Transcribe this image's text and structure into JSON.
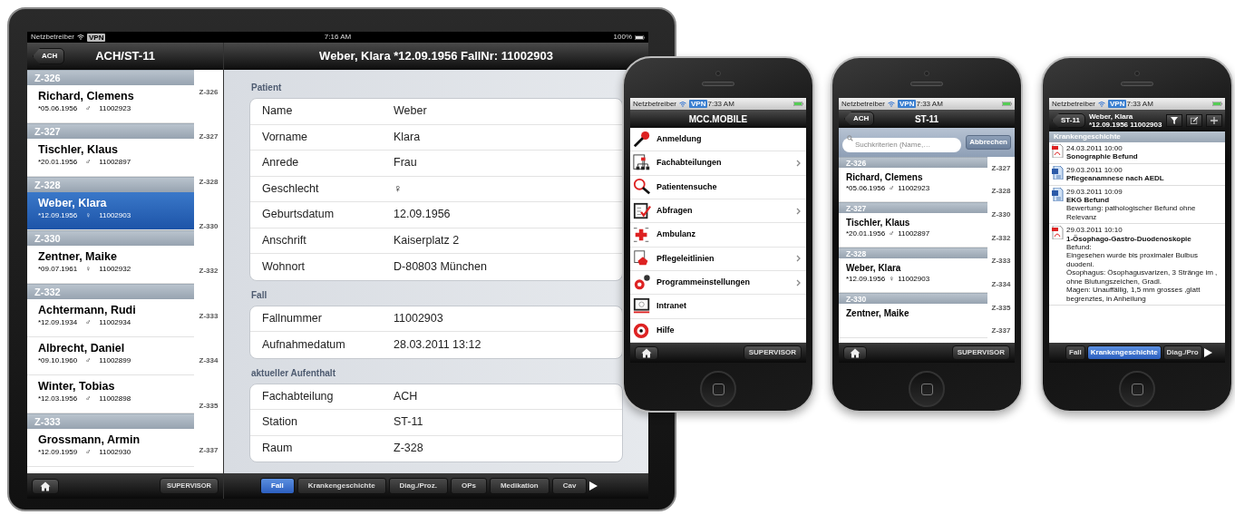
{
  "ipad": {
    "status_bar": {
      "carrier": "Netzbetreiber",
      "vpn": "VPN",
      "time": "7:16 AM",
      "battery": "100%"
    },
    "left_panel": {
      "back_button": "ACH",
      "title": "ACH/ST-11",
      "sections": [
        {
          "header": "Z-326",
          "patients": [
            {
              "name": "Richard, Clemens",
              "birth": "*05.06.1956",
              "sex": "♂",
              "case": "11002923",
              "selected": false
            }
          ]
        },
        {
          "header": "Z-327",
          "patients": [
            {
              "name": "Tischler, Klaus",
              "birth": "*20.01.1956",
              "sex": "♂",
              "case": "11002897",
              "selected": false
            }
          ]
        },
        {
          "header": "Z-328",
          "patients": [
            {
              "name": "Weber, Klara",
              "birth": "*12.09.1956",
              "sex": "♀",
              "case": "11002903",
              "selected": true
            }
          ]
        },
        {
          "header": "Z-330",
          "patients": [
            {
              "name": "Zentner, Maike",
              "birth": "*09.07.1961",
              "sex": "♀",
              "case": "11002932",
              "selected": false
            }
          ]
        },
        {
          "header": "Z-332",
          "patients": [
            {
              "name": "Achtermann, Rudi",
              "birth": "*12.09.1934",
              "sex": "♂",
              "case": "11002934",
              "selected": false
            },
            {
              "name": "Albrecht, Daniel",
              "birth": "*09.10.1960",
              "sex": "♂",
              "case": "11002899",
              "selected": false
            },
            {
              "name": "Winter, Tobias",
              "birth": "*12.03.1956",
              "sex": "♂",
              "case": "11002898",
              "selected": false
            }
          ]
        },
        {
          "header": "Z-333",
          "patients": [
            {
              "name": "Grossmann, Armin",
              "birth": "*12.09.1959",
              "sex": "♂",
              "case": "11002930",
              "selected": false
            }
          ]
        }
      ],
      "index": [
        "Z-326",
        "Z-327",
        "Z-328",
        "Z-330",
        "Z-332",
        "Z-333",
        "Z-334",
        "Z-335",
        "Z-337"
      ],
      "toolbar": {
        "right_button": "SUPERVISOR"
      }
    },
    "right_panel": {
      "title": "Weber, Klara *12.09.1956 FallNr: 11002903",
      "groups": [
        {
          "header": "Patient",
          "rows": [
            {
              "label": "Name",
              "value": "Weber"
            },
            {
              "label": "Vorname",
              "value": "Klara"
            },
            {
              "label": "Anrede",
              "value": "Frau"
            },
            {
              "label": "Geschlecht",
              "value": "♀"
            },
            {
              "label": "Geburtsdatum",
              "value": "12.09.1956"
            },
            {
              "label": "Anschrift",
              "value": "Kaiserplatz 2"
            },
            {
              "label": "Wohnort",
              "value": "D-80803 München"
            }
          ]
        },
        {
          "header": "Fall",
          "rows": [
            {
              "label": "Fallnummer",
              "value": "11002903"
            },
            {
              "label": "Aufnahmedatum",
              "value": "28.03.2011  13:12"
            }
          ]
        },
        {
          "header": "aktueller Aufenthalt",
          "rows": [
            {
              "label": "Fachabteilung",
              "value": "ACH"
            },
            {
              "label": "Station",
              "value": "ST-11"
            },
            {
              "label": "Raum",
              "value": "Z-328"
            }
          ]
        }
      ],
      "tabs": [
        {
          "label": "Fall",
          "selected": true
        },
        {
          "label": "Krankengeschichte",
          "selected": false
        },
        {
          "label": "Diag./Proz.",
          "selected": false
        },
        {
          "label": "OPs",
          "selected": false
        },
        {
          "label": "Medikation",
          "selected": false
        },
        {
          "label": "Cav",
          "selected": false
        }
      ]
    }
  },
  "phones": [
    {
      "kind": "menu",
      "status_bar": {
        "carrier": "Netzbetreiber",
        "time": "7:33 AM",
        "vpn": "VPN"
      },
      "title": "MCC.MOBILE",
      "items": [
        {
          "label": "Anmeldung",
          "chevron": false
        },
        {
          "label": "Fachabteilungen",
          "chevron": true
        },
        {
          "label": "Patientensuche",
          "chevron": false
        },
        {
          "label": "Abfragen",
          "chevron": true
        },
        {
          "label": "Ambulanz",
          "chevron": false
        },
        {
          "label": "Pflegeleitlinien",
          "chevron": true
        },
        {
          "label": "Programmeinstellungen",
          "chevron": true
        },
        {
          "label": "Intranet",
          "chevron": false
        },
        {
          "label": "Hilfe",
          "chevron": false
        }
      ],
      "toolbar": {
        "right_button": "SUPERVISOR"
      }
    },
    {
      "kind": "list",
      "status_bar": {
        "carrier": "Netzbetreiber",
        "time": "7:33 AM",
        "vpn": "VPN"
      },
      "back_button": "ACH",
      "title": "ST-11",
      "search": {
        "placeholder": "Suchkriterien (Name,…",
        "cancel": "Abbrechen"
      },
      "sections": [
        {
          "header": "Z-326",
          "patients": [
            {
              "name": "Richard, Clemens",
              "birth": "*05.06.1956",
              "sex": "♂",
              "case": "11002923",
              "selected": false
            }
          ]
        },
        {
          "header": "Z-327",
          "patients": [
            {
              "name": "Tischler, Klaus",
              "birth": "*20.01.1956",
              "sex": "♂",
              "case": "11002897",
              "selected": false
            }
          ]
        },
        {
          "header": "Z-328",
          "patients": [
            {
              "name": "Weber, Klara",
              "birth": "*12.09.1956",
              "sex": "♀",
              "case": "11002903",
              "selected": false
            }
          ]
        },
        {
          "header": "Z-330",
          "patients": [
            {
              "name": "Zentner, Maike",
              "selected": false
            }
          ]
        }
      ],
      "index": [
        "Z-327",
        "Z-328",
        "Z-330",
        "Z-332",
        "Z-333",
        "Z-334",
        "Z-335",
        "Z-337"
      ],
      "toolbar": {
        "right_button": "SUPERVISOR"
      }
    },
    {
      "kind": "history",
      "status_bar": {
        "carrier": "Netzbetreiber",
        "time": "7:33 AM",
        "vpn": "VPN"
      },
      "back_button": "ST-11",
      "title": "Weber, Klara",
      "subtitle": "*12.09.1956 11002903",
      "section": "Krankengeschichte",
      "entries": [
        {
          "kind": "pdf",
          "date": "24.03.2011 10:00",
          "title": "Sonographie Befund"
        },
        {
          "kind": "word",
          "date": "29.03.2011 10:00",
          "title": "Pflegeanamnese nach AEDL"
        },
        {
          "kind": "word",
          "date": "29.03.2011 10:09",
          "title": "EKG Befund",
          "body": [
            "Bewertung: pathologischer Befund ohne Relevanz"
          ]
        },
        {
          "kind": "pdf",
          "date": "29.03.2011 10:10",
          "title": "1-Ösophago-Gastro-Duodenoskopie",
          "body": [
            "Befund:",
            "Eingesehen wurde bis proximaler Bulbus duodeni.",
            "Ösophagus: Ösophagusvarizen, 3 Stränge im , ohne Blutungszeichen, Gradl.",
            "Magen: Unauffällig, 1,5 mm grosses ,glatt begrenztes, in Anheilung"
          ]
        }
      ],
      "tabs": [
        {
          "label": "Fall",
          "selected": false
        },
        {
          "label": "Krankengeschichte",
          "selected": true
        },
        {
          "label": "Diag./Pro",
          "selected": false
        }
      ]
    }
  ]
}
